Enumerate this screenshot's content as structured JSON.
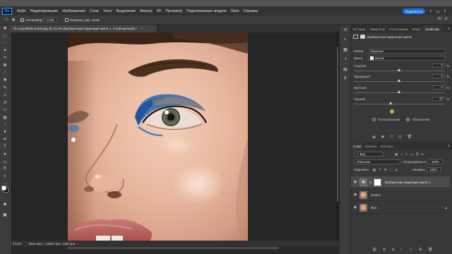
{
  "menubar": {
    "logo": "Ps",
    "items": [
      "Файл",
      "Редактирование",
      "Изображение",
      "Слои",
      "Текст",
      "Выделение",
      "Фильтр",
      "3D",
      "Просмотр",
      "Подключаемые модули",
      "Окно",
      "Справка"
    ],
    "share_label": "Поделиться"
  },
  "options": {
    "autoselect_label": "Автовыбор:",
    "autoselect_value": "Слой",
    "show_controls_label": "Показать упр. элем."
  },
  "document": {
    "tab_title": "01.may16625 копия.jpg @ 24,4% (Выборочная коррекция цвета 1, Слой-маска/8) *",
    "zoom": "24,4%",
    "info": "3024 пикс. x 4846 пикс. (300 ppi)"
  },
  "panel_tabs_top": [
    "История",
    "Навигатор",
    "Гистограмма",
    "Инфо",
    "Свойства"
  ],
  "properties": {
    "title": "Выборочная коррекция цвета",
    "preset_label": "Набор:",
    "preset_value": "Заказная",
    "colors_label": "Цвета:",
    "colors_value": "Белые",
    "sliders": [
      {
        "label": "Голубой:",
        "value": "0",
        "unit": "%",
        "level": 0.5
      },
      {
        "label": "Пурпурный:",
        "value": "0",
        "unit": "%",
        "level": 0.5
      },
      {
        "label": "Желтый:",
        "value": "0",
        "unit": "%",
        "level": 0.5
      },
      {
        "label": "Черный:",
        "value": "-19",
        "unit": "%",
        "level": 0.405
      }
    ],
    "method_relative": "Относительная",
    "method_absolute": "Абсолютная"
  },
  "panel_tabs_bottom": [
    "Слои",
    "Каналы",
    "Контуры"
  ],
  "layers": {
    "kind_value": "Вид",
    "blend_value": "Обычные",
    "opacity_label": "Непрозрачность:",
    "opacity_value": "100%",
    "lock_label": "Закрепить:",
    "fill_label": "Заливка:",
    "fill_value": "100%",
    "items": [
      {
        "name": "Выборочная коррекция цвета 1"
      },
      {
        "name": "Слой 1"
      },
      {
        "name": "Фон"
      }
    ]
  }
}
